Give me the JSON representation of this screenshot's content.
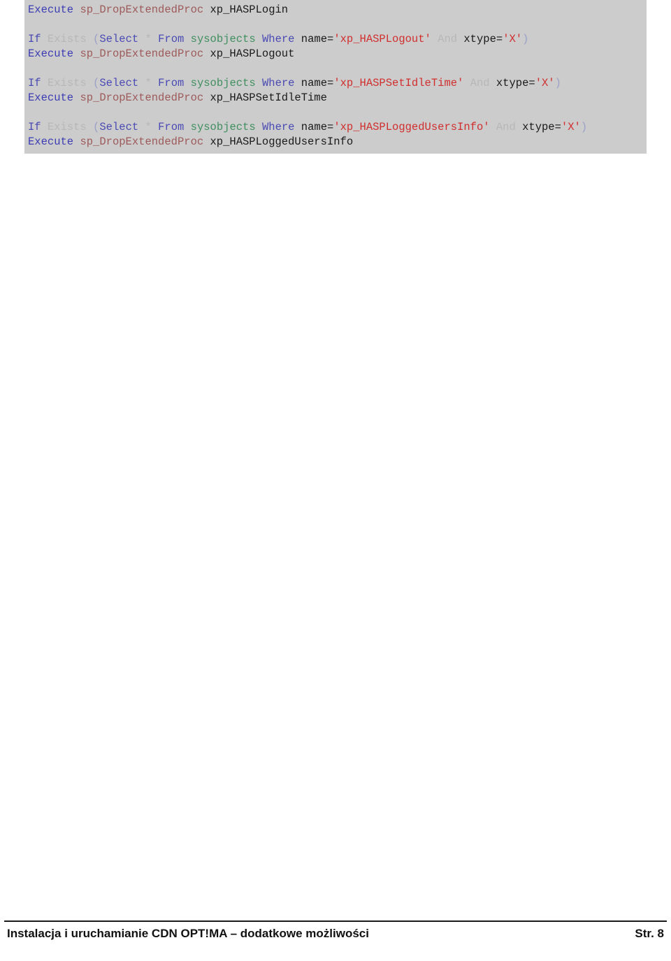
{
  "document": {
    "page_background": "#ffffff",
    "code_background": "#cccccc"
  },
  "code_block": {
    "language": "sql",
    "colors": {
      "execute": "#3c3cb4",
      "procedure": "#9e5a5a",
      "keyword": "#4a4ab4",
      "dim": "#b7b7b7",
      "table": "#3f8f5f",
      "string": "#d12e2e",
      "plain": "#1a1a1a"
    },
    "lines": [
      {
        "id": "l1",
        "tokens": [
          {
            "t": "Execute",
            "c": "exec"
          },
          {
            "t": " ",
            "c": "plain"
          },
          {
            "t": "sp_DropExtendedProc",
            "c": "proc"
          },
          {
            "t": " ",
            "c": "plain"
          },
          {
            "t": "xp_HASPLogin",
            "c": "plain"
          }
        ]
      },
      {
        "id": "l2",
        "blank": true,
        "tokens": []
      },
      {
        "id": "l3",
        "tokens": [
          {
            "t": "If",
            "c": "kw"
          },
          {
            "t": " ",
            "c": "plain"
          },
          {
            "t": "Exists",
            "c": "dim"
          },
          {
            "t": " ",
            "c": "plain"
          },
          {
            "t": "(",
            "c": "paren"
          },
          {
            "t": "Select",
            "c": "kw"
          },
          {
            "t": " ",
            "c": "plain"
          },
          {
            "t": "*",
            "c": "dim"
          },
          {
            "t": " ",
            "c": "plain"
          },
          {
            "t": "From",
            "c": "kw"
          },
          {
            "t": " ",
            "c": "plain"
          },
          {
            "t": "sysobjects",
            "c": "table"
          },
          {
            "t": " ",
            "c": "plain"
          },
          {
            "t": "Where",
            "c": "kw"
          },
          {
            "t": " ",
            "c": "plain"
          },
          {
            "t": "name=",
            "c": "plain"
          },
          {
            "t": "'xp_HASPLogout'",
            "c": "str"
          },
          {
            "t": " ",
            "c": "plain"
          },
          {
            "t": "And",
            "c": "dim"
          },
          {
            "t": " ",
            "c": "plain"
          },
          {
            "t": "xtype=",
            "c": "plain"
          },
          {
            "t": "'X'",
            "c": "str"
          },
          {
            "t": ")",
            "c": "paren"
          }
        ]
      },
      {
        "id": "l4",
        "tokens": [
          {
            "t": "Execute",
            "c": "exec"
          },
          {
            "t": " ",
            "c": "plain"
          },
          {
            "t": "sp_DropExtendedProc",
            "c": "proc"
          },
          {
            "t": " ",
            "c": "plain"
          },
          {
            "t": "xp_HASPLogout",
            "c": "plain"
          }
        ]
      },
      {
        "id": "l5",
        "blank": true,
        "tokens": []
      },
      {
        "id": "l6",
        "tokens": [
          {
            "t": "If",
            "c": "kw"
          },
          {
            "t": " ",
            "c": "plain"
          },
          {
            "t": "Exists",
            "c": "dim"
          },
          {
            "t": " ",
            "c": "plain"
          },
          {
            "t": "(",
            "c": "paren"
          },
          {
            "t": "Select",
            "c": "kw"
          },
          {
            "t": " ",
            "c": "plain"
          },
          {
            "t": "*",
            "c": "dim"
          },
          {
            "t": " ",
            "c": "plain"
          },
          {
            "t": "From",
            "c": "kw"
          },
          {
            "t": " ",
            "c": "plain"
          },
          {
            "t": "sysobjects",
            "c": "table"
          },
          {
            "t": " ",
            "c": "plain"
          },
          {
            "t": "Where",
            "c": "kw"
          },
          {
            "t": " ",
            "c": "plain"
          },
          {
            "t": "name=",
            "c": "plain"
          },
          {
            "t": "'xp_HASPSetIdleTime'",
            "c": "str"
          },
          {
            "t": " ",
            "c": "plain"
          },
          {
            "t": "And",
            "c": "dim"
          },
          {
            "t": " ",
            "c": "plain"
          },
          {
            "t": "xtype=",
            "c": "plain"
          },
          {
            "t": "'X'",
            "c": "str"
          },
          {
            "t": ")",
            "c": "paren"
          }
        ]
      },
      {
        "id": "l7",
        "tokens": [
          {
            "t": "Execute",
            "c": "exec"
          },
          {
            "t": " ",
            "c": "plain"
          },
          {
            "t": "sp_DropExtendedProc",
            "c": "proc"
          },
          {
            "t": " ",
            "c": "plain"
          },
          {
            "t": "xp_HASPSetIdleTime",
            "c": "plain"
          }
        ]
      },
      {
        "id": "l8",
        "blank": true,
        "tokens": []
      },
      {
        "id": "l9",
        "tokens": [
          {
            "t": "If",
            "c": "kw"
          },
          {
            "t": " ",
            "c": "plain"
          },
          {
            "t": "Exists",
            "c": "dim"
          },
          {
            "t": " ",
            "c": "plain"
          },
          {
            "t": "(",
            "c": "paren"
          },
          {
            "t": "Select",
            "c": "kw"
          },
          {
            "t": " ",
            "c": "plain"
          },
          {
            "t": "*",
            "c": "dim"
          },
          {
            "t": " ",
            "c": "plain"
          },
          {
            "t": "From",
            "c": "kw"
          },
          {
            "t": " ",
            "c": "plain"
          },
          {
            "t": "sysobjects",
            "c": "table"
          },
          {
            "t": " ",
            "c": "plain"
          },
          {
            "t": "Where",
            "c": "kw"
          },
          {
            "t": " ",
            "c": "plain"
          },
          {
            "t": "name=",
            "c": "plain"
          },
          {
            "t": "'xp_HASPLoggedUsersInfo'",
            "c": "str"
          },
          {
            "t": " ",
            "c": "plain"
          },
          {
            "t": "And",
            "c": "dim"
          },
          {
            "t": " ",
            "c": "plain"
          },
          {
            "t": "xtype=",
            "c": "plain"
          },
          {
            "t": "'X'",
            "c": "str"
          },
          {
            "t": ")",
            "c": "paren"
          }
        ]
      },
      {
        "id": "l10",
        "tokens": [
          {
            "t": "Execute",
            "c": "exec"
          },
          {
            "t": " ",
            "c": "plain"
          },
          {
            "t": "sp_DropExtendedProc",
            "c": "proc"
          },
          {
            "t": " ",
            "c": "plain"
          },
          {
            "t": "xp_HASPLoggedUsersInfo",
            "c": "plain"
          }
        ]
      }
    ]
  },
  "footer": {
    "left_text": "Instalacja i uruchamianie CDN OPT!MA – dodatkowe możliwości",
    "right_text": "Str. 8"
  }
}
